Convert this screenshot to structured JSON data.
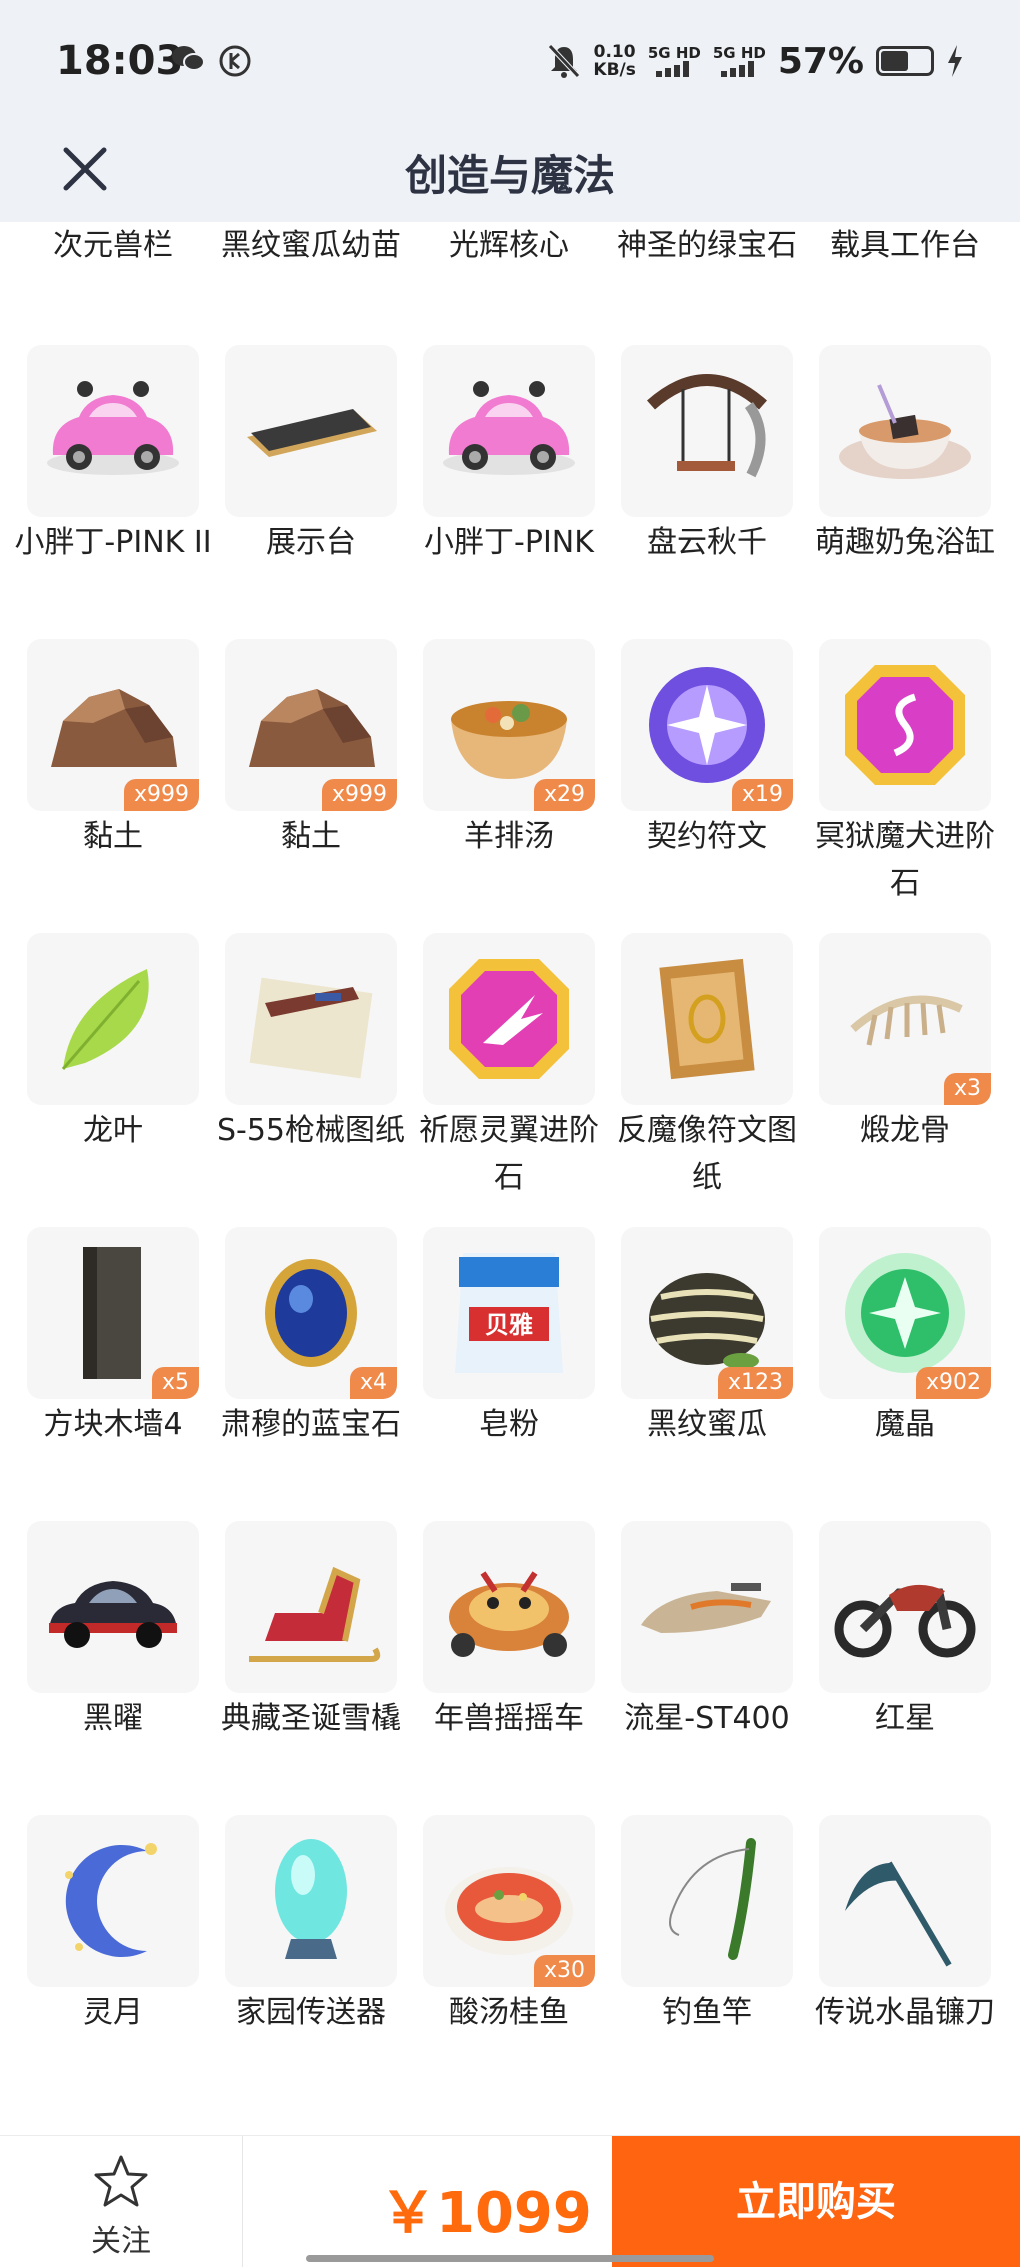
{
  "status_bar": {
    "time": "18:03",
    "net_speed_value": "0.10",
    "net_speed_unit": "KB/s",
    "sig1": "5G HD",
    "sig2": "5G HD",
    "battery": "57%",
    "battery_level": 0.57
  },
  "header": {
    "title": "创造与魔法"
  },
  "top_row_labels": [
    "次元兽栏",
    "黑纹蜜瓜幼苗",
    "光辉核心",
    "神圣的绿宝石",
    "载具工作台"
  ],
  "items": [
    {
      "label": "小胖丁-PINK II",
      "qty": "",
      "icon": "pink-car-icon"
    },
    {
      "label": "展示台",
      "qty": "",
      "icon": "display-stand-icon"
    },
    {
      "label": "小胖丁-PINK",
      "qty": "",
      "icon": "pink-car-icon"
    },
    {
      "label": "盘云秋千",
      "qty": "",
      "icon": "swing-icon"
    },
    {
      "label": "萌趣奶兔浴缸",
      "qty": "",
      "icon": "teacup-bathtub-icon"
    },
    {
      "label": "黏土",
      "qty": "x999",
      "icon": "clay-icon"
    },
    {
      "label": "黏土",
      "qty": "x999",
      "icon": "clay-icon"
    },
    {
      "label": "羊排汤",
      "qty": "x29",
      "icon": "soup-bowl-icon"
    },
    {
      "label": "契约符文",
      "qty": "x19",
      "icon": "rune-icon"
    },
    {
      "label": "冥狱魔犬进阶石",
      "qty": "",
      "icon": "pink-gem-icon"
    },
    {
      "label": "龙叶",
      "qty": "",
      "icon": "leaf-icon"
    },
    {
      "label": "S-55枪械图纸",
      "qty": "",
      "icon": "blueprint-icon"
    },
    {
      "label": "祈愿灵翼进阶石",
      "qty": "",
      "icon": "wing-gem-icon"
    },
    {
      "label": "反魔像符文图纸",
      "qty": "",
      "icon": "scroll-icon"
    },
    {
      "label": "煅龙骨",
      "qty": "x3",
      "icon": "bone-icon"
    },
    {
      "label": "方块木墙4",
      "qty": "x5",
      "icon": "wood-wall-icon"
    },
    {
      "label": "肃穆的蓝宝石",
      "qty": "x4",
      "icon": "sapphire-icon"
    },
    {
      "label": "皂粉",
      "qty": "",
      "icon": "soap-powder-icon"
    },
    {
      "label": "黑纹蜜瓜",
      "qty": "x123",
      "icon": "melon-icon"
    },
    {
      "label": "魔晶",
      "qty": "x902",
      "icon": "magic-crystal-icon"
    },
    {
      "label": "黑曜",
      "qty": "",
      "icon": "black-car-icon"
    },
    {
      "label": "典藏圣诞雪橇",
      "qty": "",
      "icon": "sleigh-icon"
    },
    {
      "label": "年兽摇摇车",
      "qty": "",
      "icon": "beast-car-icon"
    },
    {
      "label": "流星-ST400",
      "qty": "",
      "icon": "hover-bike-icon"
    },
    {
      "label": "红星",
      "qty": "",
      "icon": "motorcycle-icon"
    },
    {
      "label": "灵月",
      "qty": "",
      "icon": "moon-icon"
    },
    {
      "label": "家园传送器",
      "qty": "",
      "icon": "teleporter-icon"
    },
    {
      "label": "酸汤桂鱼",
      "qty": "x30",
      "icon": "fish-dish-icon"
    },
    {
      "label": "钓鱼竿",
      "qty": "",
      "icon": "fishing-rod-icon"
    },
    {
      "label": "传说水晶镰刀",
      "qty": "",
      "icon": "scythe-icon"
    }
  ],
  "bottom_bar": {
    "follow_label": "关注",
    "price": "￥1099",
    "buy_label": "立即购买"
  },
  "colors": {
    "accent": "#ff6410",
    "price": "#ff6a0d",
    "badge": "#f08a4b",
    "header_bg": "#eef1f6"
  }
}
